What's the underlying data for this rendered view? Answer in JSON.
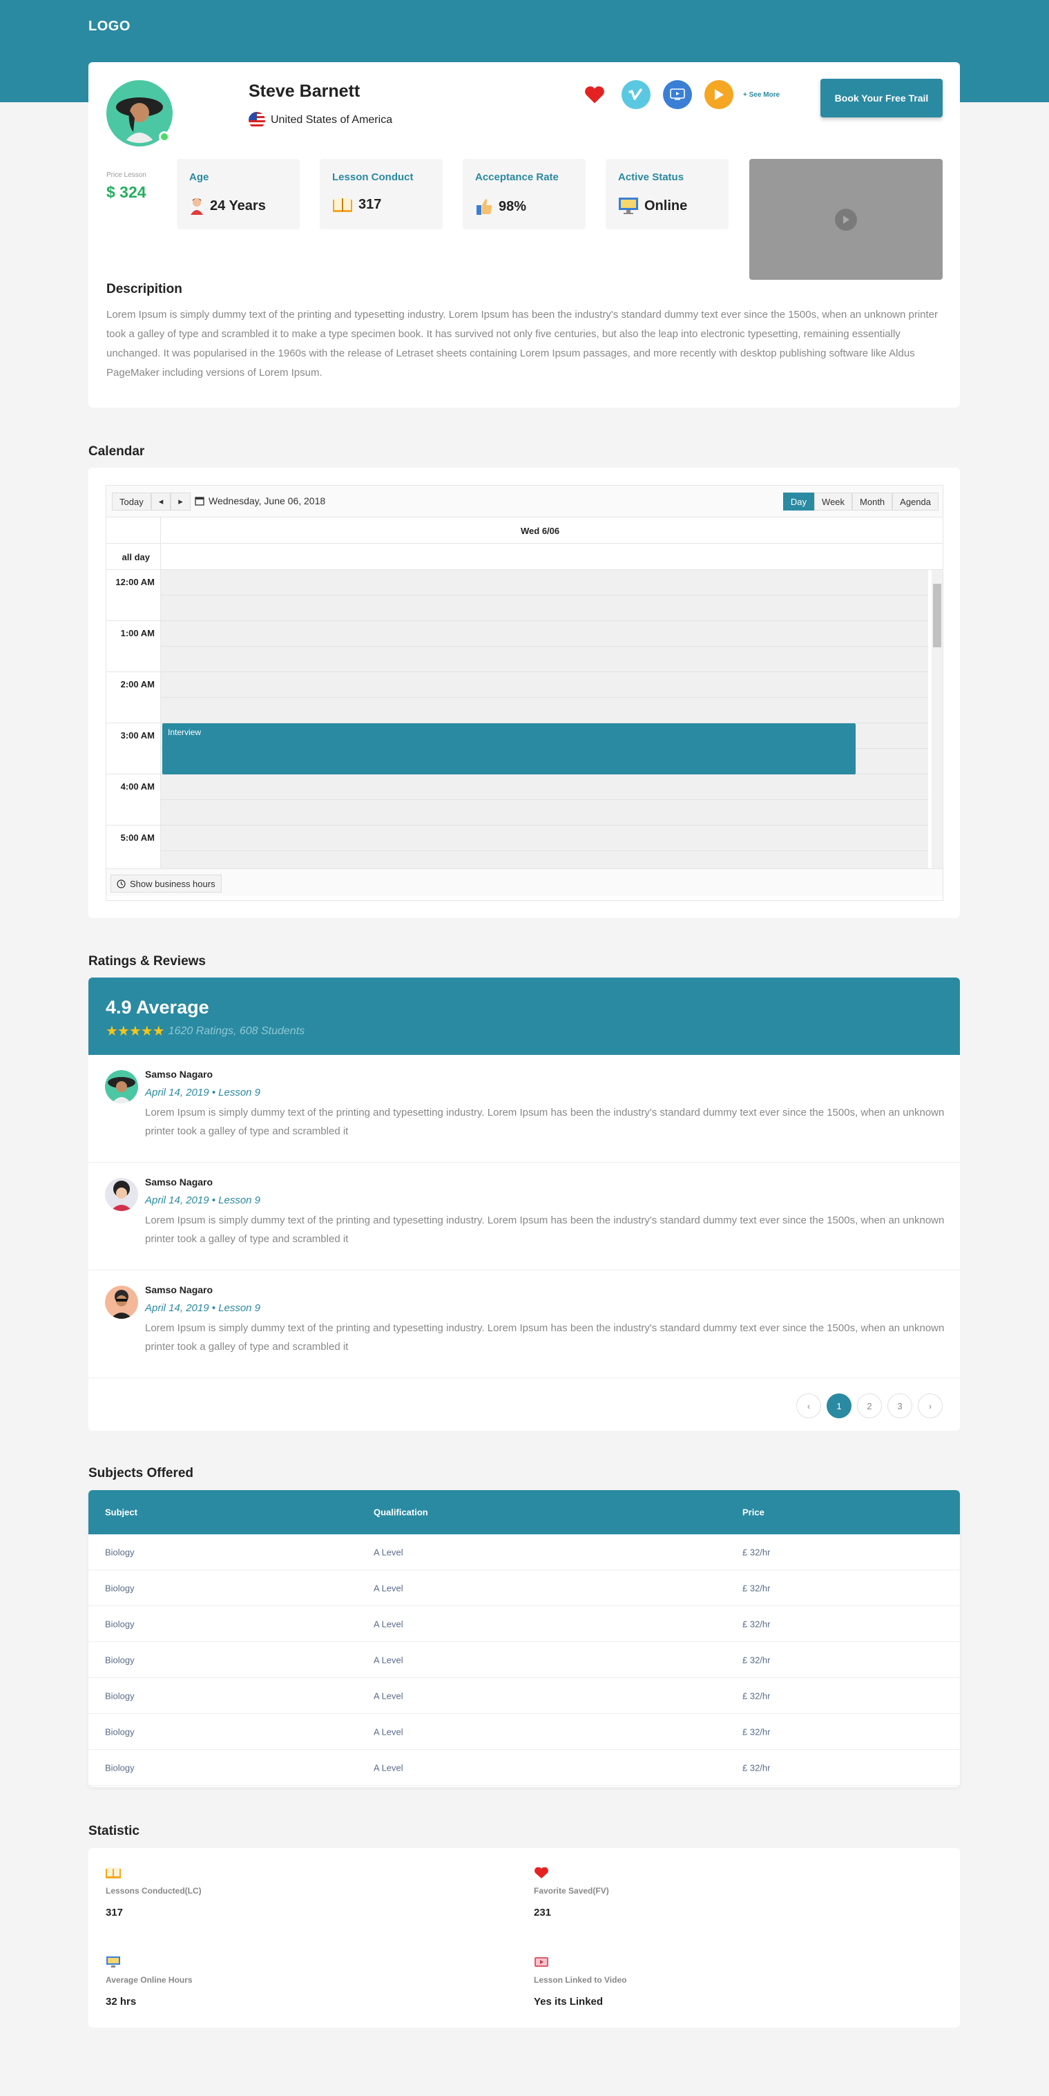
{
  "header": {
    "logo": "LOGO"
  },
  "profile": {
    "name": "Steve Barnett",
    "country": "United States of America",
    "see_more": "+ See More",
    "book_button": "Book Your Free Trail",
    "price_label": "Price Lesson",
    "price_value": "$ 324",
    "stats": [
      {
        "label": "Age",
        "value": "24 Years",
        "icon": "person-icon"
      },
      {
        "label": "Lesson Conduct",
        "value": "317",
        "icon": "book-icon"
      },
      {
        "label": "Acceptance Rate",
        "value": "98%",
        "icon": "thumbs-up-icon"
      },
      {
        "label": "Active Status",
        "value": "Online",
        "icon": "monitor-icon"
      }
    ],
    "description_title": "Descripition",
    "description": "Lorem Ipsum is simply dummy text of the printing and typesetting industry. Lorem Ipsum has been the industry's standard dummy text ever since the 1500s, when an unknown printer took a galley of type and scrambled it to make a type specimen book. It has survived not only five centuries, but also the leap into electronic typesetting, remaining essentially unchanged. It was popularised in the 1960s with the release of Letraset sheets containing Lorem Ipsum passages, and more recently with desktop publishing software like Aldus PageMaker including versions of Lorem Ipsum."
  },
  "calendar": {
    "title": "Calendar",
    "today": "Today",
    "prev": "◂",
    "next": "▸",
    "date": "Wednesday, June 06, 2018",
    "views": [
      "Day",
      "Week",
      "Month",
      "Agenda"
    ],
    "active_view": "Day",
    "day_header": "Wed 6/06",
    "all_day": "all day",
    "hours": [
      "12:00 AM",
      "1:00 AM",
      "2:00 AM",
      "3:00 AM",
      "4:00 AM",
      "5:00 AM"
    ],
    "event": "Interview",
    "business_hours": "Show business hours"
  },
  "reviews": {
    "title": "Ratings & Reviews",
    "average": "4.9 Average",
    "stars": "★★★★★",
    "counts": "1620 Ratings, 608 Students",
    "items": [
      {
        "name": "Samso Nagaro",
        "meta": "April 14, 2019  •  Lesson 9",
        "text": "Lorem Ipsum is simply dummy text of the printing and typesetting industry. Lorem Ipsum has been the industry's standard dummy text ever since the 1500s, when an unknown printer took a galley of type and scrambled it"
      },
      {
        "name": "Samso Nagaro",
        "meta": "April 14, 2019  •  Lesson 9",
        "text": "Lorem Ipsum is simply dummy text of the printing and typesetting industry. Lorem Ipsum has been the industry's standard dummy text ever since the 1500s, when an unknown printer took a galley of type and scrambled it"
      },
      {
        "name": "Samso Nagaro",
        "meta": "April 14, 2019  •  Lesson 9",
        "text": "Lorem Ipsum is simply dummy text of the printing and typesetting industry. Lorem Ipsum has been the industry's standard dummy text ever since the 1500s, when an unknown printer took a galley of type and scrambled it"
      }
    ],
    "pages": [
      "1",
      "2",
      "3"
    ],
    "current_page": "1"
  },
  "subjects": {
    "title": "Subjects Offered",
    "columns": [
      "Subject",
      "Qualification",
      "Price"
    ],
    "rows": [
      [
        "Biology",
        "A Level",
        "£ 32/hr"
      ],
      [
        "Biology",
        "A Level",
        "£ 32/hr"
      ],
      [
        "Biology",
        "A Level",
        "£ 32/hr"
      ],
      [
        "Biology",
        "A Level",
        "£ 32/hr"
      ],
      [
        "Biology",
        "A Level",
        "£ 32/hr"
      ],
      [
        "Biology",
        "A Level",
        "£ 32/hr"
      ],
      [
        "Biology",
        "A Level",
        "£ 32/hr"
      ]
    ]
  },
  "statistic": {
    "title": "Statistic",
    "items": [
      {
        "label": "Lessons Conducted(LC)",
        "value": "317",
        "icon": "book-icon"
      },
      {
        "label": "Favorite Saved(FV)",
        "value": "231",
        "icon": "heart-icon"
      },
      {
        "label": "Average Online Hours",
        "value": "32 hrs",
        "icon": "monitor-icon"
      },
      {
        "label": "Lesson Linked to Video",
        "value": "Yes its Linked",
        "icon": "video-icon"
      }
    ]
  },
  "colors": {
    "primary": "#2a8aa1",
    "price": "#27ae60",
    "star": "#f5c518",
    "online": "#4cd964"
  }
}
